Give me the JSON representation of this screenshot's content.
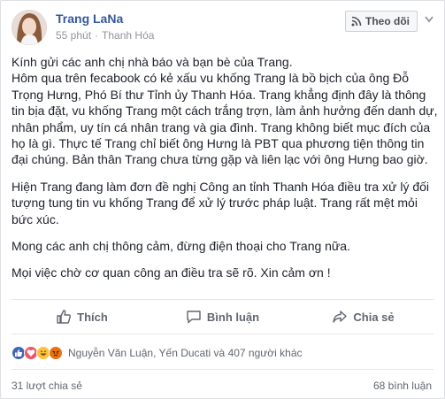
{
  "post": {
    "author_name": "Trang LaNa",
    "time": "55 phút",
    "separator": "·",
    "location": "Thanh Hóa",
    "follow_label": "Theo dõi",
    "paragraphs": [
      "Kính gửi các anh chị nhà báo và bạn bè của Trang.\nHôm qua trên fecabook có kẻ xấu vu khống Trang là bồ bịch của ông Đỗ Trọng Hưng, Phó Bí thư Tỉnh ủy Thanh Hóa. Trang khẳng định đây là thông tin bịa đặt, vu khống Trang một cách trắng trợn, làm ảnh hưởng đến danh dự, nhân phẩm, uy tín cá nhân trang và gia đình. Trang không biết mục đích của họ là gì. Thực tế Trang chỉ biết ông Hưng là PBT qua phương tiện thông tin đại chúng. Bản thân Trang chưa từng gặp và liên lạc với ông Hưng bao giờ.",
      "Hiện Trang đang làm đơn đề nghị Công an tỉnh Thanh Hóa điều tra xử lý đối tượng tung tin vu khống Trang để xử lý trước pháp luật. Trang rất mệt mỏi bức xúc.",
      "Mong các anh chị thông cảm, đừng điện thoại cho Trang nữa.",
      "Mọi việc chờ cơ quan công an điều tra sẽ rõ. Xin cảm ơn !"
    ]
  },
  "actions": {
    "like_label": "Thích",
    "comment_label": "Bình luận",
    "share_label": "Chia sẻ"
  },
  "reactions": {
    "icons": [
      "like-reaction-icon",
      "love-reaction-icon",
      "haha-reaction-icon",
      "angry-reaction-icon"
    ],
    "summary": "Nguyễn Văn Luận, Yến Ducati và 407 người khác"
  },
  "stats": {
    "shares": "31 lượt chia sẻ",
    "comments": "68 bình luận"
  },
  "colors": {
    "author_link": "#365899",
    "like_blue": "#4267b2",
    "love_red": "#f25268",
    "haha_yellow": "#fcc13f",
    "angry_orange": "#e9710f"
  }
}
